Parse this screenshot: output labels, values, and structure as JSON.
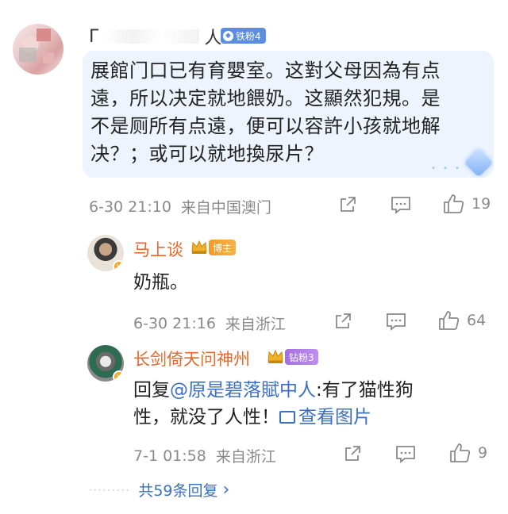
{
  "main_comment": {
    "username_prefix": "Г",
    "username_suffix": "人",
    "fan_badge": "铁粉4",
    "text_lines": [
      "展館门口已有育嬰室。这對父母因為有点",
      "遠，所以决定就地餵奶。这顯然犯規。是",
      "不是厕所有点遠，便可以容許小孩就地解",
      "决？；或可以就地換尿片？"
    ],
    "time": "6-30 21:10",
    "source": "来自中国澳门",
    "likes": "19"
  },
  "replies": [
    {
      "name": "马上谈",
      "badge": "博主",
      "text": "奶瓶。",
      "time": "6-30 21:16",
      "source": "来自浙江",
      "likes": "64"
    },
    {
      "name": "长剑倚天问神州",
      "badge": "钻粉3",
      "text_prefix": "回复",
      "mention": "@原是碧落賦中人",
      "text_line1_rest": ":有了猫性狗",
      "text_line2": "性，就没了人性！",
      "view_image": "查看图片",
      "time": "7-1 01:58",
      "source": "来自浙江",
      "likes": "9"
    }
  ],
  "more_replies": "共59条回复",
  "more_arrow": "›",
  "icons": {
    "share": "share-icon",
    "comment": "comment-icon",
    "like": "thumbs-up-icon"
  },
  "colors": {
    "bubble_bg": "#eef4fd",
    "link": "#3b6fc2",
    "reply_name": "#e8672b",
    "meta": "#8a8a8a"
  }
}
